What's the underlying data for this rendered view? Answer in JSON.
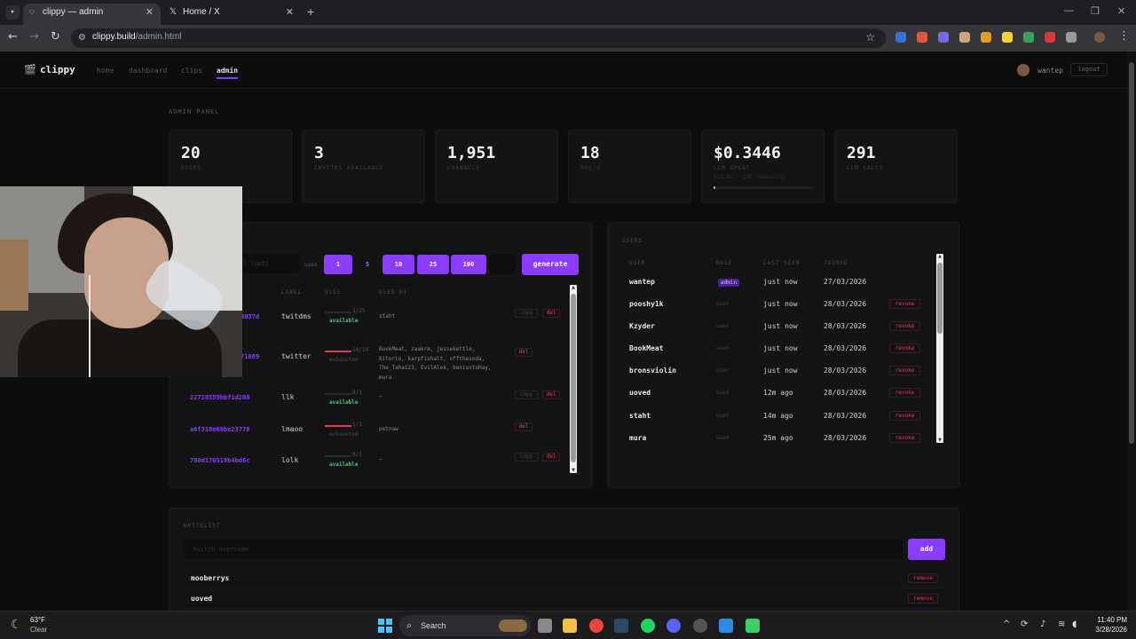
{
  "browser": {
    "tabs": [
      {
        "title": "clippy — admin",
        "active": true
      },
      {
        "title": "Home / X",
        "active": false
      }
    ],
    "url_host": "clippy.build",
    "url_path": "/admin.html"
  },
  "nav": {
    "logo": "clippy",
    "links": [
      "home",
      "dashboard",
      "clips",
      "admin"
    ],
    "active": "admin",
    "username": "wantep",
    "logout": "logout"
  },
  "page_title": "ADMIN PANEL",
  "stats": [
    {
      "value": "20",
      "label": "USERS"
    },
    {
      "value": "3",
      "label": "INVITES AVAILABLE"
    },
    {
      "value": "1,951",
      "label": "CHANNELS"
    },
    {
      "value": "18",
      "label": "MSG/S"
    },
    {
      "value": "$0.3446",
      "label": "LLM SPENT",
      "sub": "$19.66 / $20 remaining",
      "progress": 0.017
    },
    {
      "value": "291",
      "label": "LLM CALLS"
    }
  ],
  "invites": {
    "label_placeholder": "label (opt)",
    "uses_label": "uses",
    "use_options": [
      "1",
      "5",
      "10",
      "25",
      "100"
    ],
    "custom_placeholder": "",
    "generate": "generate",
    "columns": [
      "LABEL",
      "USES",
      "USED BY"
    ],
    "rows": [
      {
        "code": "3037d",
        "label": "twitdms",
        "uses": "1/25",
        "status": "available",
        "used_by": "staht",
        "actions": [
          "copy",
          "del"
        ],
        "full": false
      },
      {
        "code": "71089",
        "label": "twitter",
        "uses": "10/10",
        "status": "exhausted",
        "used_by": "BookMeat, zaakra, jessekettle, kitorio, karpfishalt, offthesoda, The_Taha123, EvilAlek, benisntoHay, mura",
        "actions": [
          "del"
        ],
        "full": true
      },
      {
        "code": "22718559bbf1d208",
        "label": "llk",
        "uses": "0/1",
        "status": "available",
        "used_by": "—",
        "actions": [
          "copy",
          "del"
        ],
        "full": false
      },
      {
        "code": "a6f318e69be23778",
        "label": "lmaoo",
        "uses": "1/1",
        "status": "exhausted",
        "used_by": "petnaw",
        "actions": [
          "del"
        ],
        "full": true
      },
      {
        "code": "780d176519b4bd6c",
        "label": "lolk",
        "uses": "0/3",
        "status": "available",
        "used_by": "—",
        "actions": [
          "copy",
          "del"
        ],
        "full": false
      }
    ]
  },
  "users": {
    "label": "USERS",
    "columns": [
      "USER",
      "ROLE",
      "LAST SEEN",
      "JOINED"
    ],
    "rows": [
      {
        "name": "wantep",
        "role": "admin",
        "last_seen": "just now",
        "joined": "27/03/2026",
        "action": ""
      },
      {
        "name": "pooshy1k",
        "role": "user",
        "last_seen": "just now",
        "joined": "28/03/2026",
        "action": "revoke"
      },
      {
        "name": "Kzyder",
        "role": "user",
        "last_seen": "just now",
        "joined": "28/03/2026",
        "action": "revoke"
      },
      {
        "name": "BookMeat",
        "role": "user",
        "last_seen": "just now",
        "joined": "28/03/2026",
        "action": "revoke"
      },
      {
        "name": "bronsviolin",
        "role": "user",
        "last_seen": "just now",
        "joined": "28/03/2026",
        "action": "revoke"
      },
      {
        "name": "uoved",
        "role": "user",
        "last_seen": "12m ago",
        "joined": "28/03/2026",
        "action": "revoke"
      },
      {
        "name": "staht",
        "role": "user",
        "last_seen": "14m ago",
        "joined": "28/03/2026",
        "action": "revoke"
      },
      {
        "name": "mura",
        "role": "user",
        "last_seen": "25m ago",
        "joined": "28/03/2026",
        "action": "revoke"
      }
    ]
  },
  "whitelist": {
    "label": "WHITELIST",
    "placeholder": "twitch username",
    "add": "add",
    "entries": [
      {
        "name": "mooberrys",
        "action": "remove"
      },
      {
        "name": "uoved",
        "action": "remove"
      }
    ]
  },
  "taskbar": {
    "temp": "63°F",
    "weather": "Clear",
    "search": "Search",
    "time": "11:40 PM",
    "date": "3/28/2026"
  },
  "colors": {
    "accent": "#8b3dff",
    "danger": "#e03b4a",
    "success": "#3ecf6a",
    "bg": "#0d0d0e",
    "panel": "#141416"
  }
}
